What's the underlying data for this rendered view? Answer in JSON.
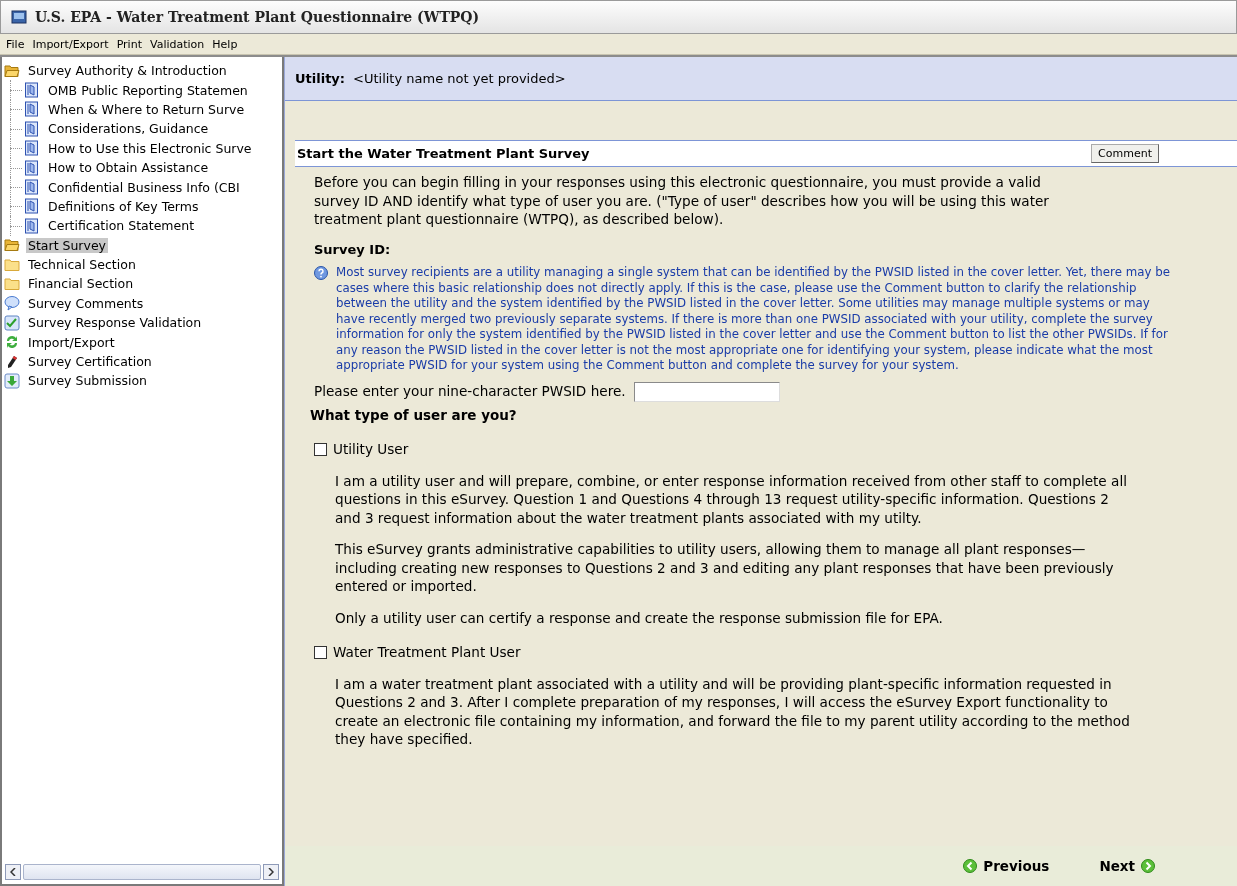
{
  "window": {
    "title": "U.S. EPA - Water Treatment Plant Questionnaire (WTPQ)"
  },
  "menu": [
    "File",
    "Import/Export",
    "Print",
    "Validation",
    "Help"
  ],
  "tree": [
    {
      "label": "Survey Authority & Introduction",
      "kind": "folder-open",
      "selected": false,
      "expanded": true,
      "children": [
        {
          "label": "OMB Public Reporting Statemen",
          "kind": "page",
          "selected": false
        },
        {
          "label": "When & Where to Return Surve",
          "kind": "page",
          "selected": false
        },
        {
          "label": "Considerations, Guidance",
          "kind": "page",
          "selected": false
        },
        {
          "label": "How to Use this Electronic Surve",
          "kind": "page",
          "selected": false
        },
        {
          "label": "How to Obtain Assistance",
          "kind": "page",
          "selected": false
        },
        {
          "label": "Confidential Business Info (CBI",
          "kind": "page",
          "selected": false
        },
        {
          "label": "Definitions of Key Terms",
          "kind": "page",
          "selected": false
        },
        {
          "label": "Certification Statement",
          "kind": "page",
          "selected": false
        }
      ]
    },
    {
      "label": "Start Survey",
      "kind": "folder-open",
      "selected": true
    },
    {
      "label": "Technical Section",
      "kind": "folder",
      "selected": false
    },
    {
      "label": "Financial Section",
      "kind": "folder",
      "selected": false
    },
    {
      "label": "Survey Comments",
      "kind": "comment",
      "selected": false
    },
    {
      "label": "Survey Response Validation",
      "kind": "check",
      "selected": false
    },
    {
      "label": "Import/Export",
      "kind": "sync",
      "selected": false
    },
    {
      "label": "Survey Certification",
      "kind": "pen",
      "selected": false
    },
    {
      "label": "Survey Submission",
      "kind": "download",
      "selected": false
    }
  ],
  "utility": {
    "label": "Utility:",
    "value": "<Utility name not yet provided>"
  },
  "section": {
    "title": "Start the Water Treatment Plant Survey",
    "comment_button": "Comment"
  },
  "intro": "Before you can begin filling in your responses using this electronic questionnaire, you must provide a valid survey ID AND identify what type of user you are.  (\"Type of user\" describes how you will be using this water treatment plant questionnaire (WTPQ), as described below).",
  "survey_id": {
    "heading": "Survey ID:",
    "info": "Most survey recipients are a utility managing a single system that can be identified by the PWSID listed in the cover letter. Yet, there may be cases where this basic relationship does not directly apply. If this is the case, please use the Comment button to clarify the relationship between the utility and the system identified by the PWSID listed in the cover letter.  Some utilities may manage multiple systems or may have recently merged two previously separate systems. If there is more than one PWSID associated with your utility, complete the survey information for only the system identified by the PWSID listed in the cover letter and use the Comment button to list the other PWSIDs. If for any reason the PWSID listed in the cover letter is not the most appropriate one for identifying your system, please indicate what the most appropriate PWSID for your system using the Comment button and complete the survey for your system.",
    "prompt": "Please enter your nine-character PWSID here."
  },
  "user_type": {
    "heading": "What type of user are you?",
    "options": [
      {
        "label": "Utility User",
        "checked": false,
        "paragraphs": [
          "I am a utility user and will prepare, combine, or enter response information received from other staff to complete all questions in this eSurvey.  Question 1 and Questions 4 through 13 request utility-specific information.  Questions 2 and 3 request information about the water treatment plants associated with my utilty.",
          "This eSurvey grants administrative capabilities to utility users, allowing them to manage all plant responses—including creating new responses to Questions 2 and 3 and editing any plant responses that have been previously entered or imported.",
          "Only a utility user can certify a response and create the response submission file for EPA."
        ]
      },
      {
        "label": "Water Treatment Plant User",
        "checked": false,
        "paragraphs": [
          "I am a water treatment plant associated with a utility and will be providing plant-specific information requested in Questions 2 and 3.  After I complete preparation of my responses, I will access the eSurvey Export functionality to create an electronic file containing my information, and forward the file to my parent utility according to the method they have specified."
        ]
      }
    ]
  },
  "nav": [
    {
      "label": "Previous",
      "kind": "previous"
    },
    {
      "label": "Next",
      "kind": "next"
    }
  ]
}
